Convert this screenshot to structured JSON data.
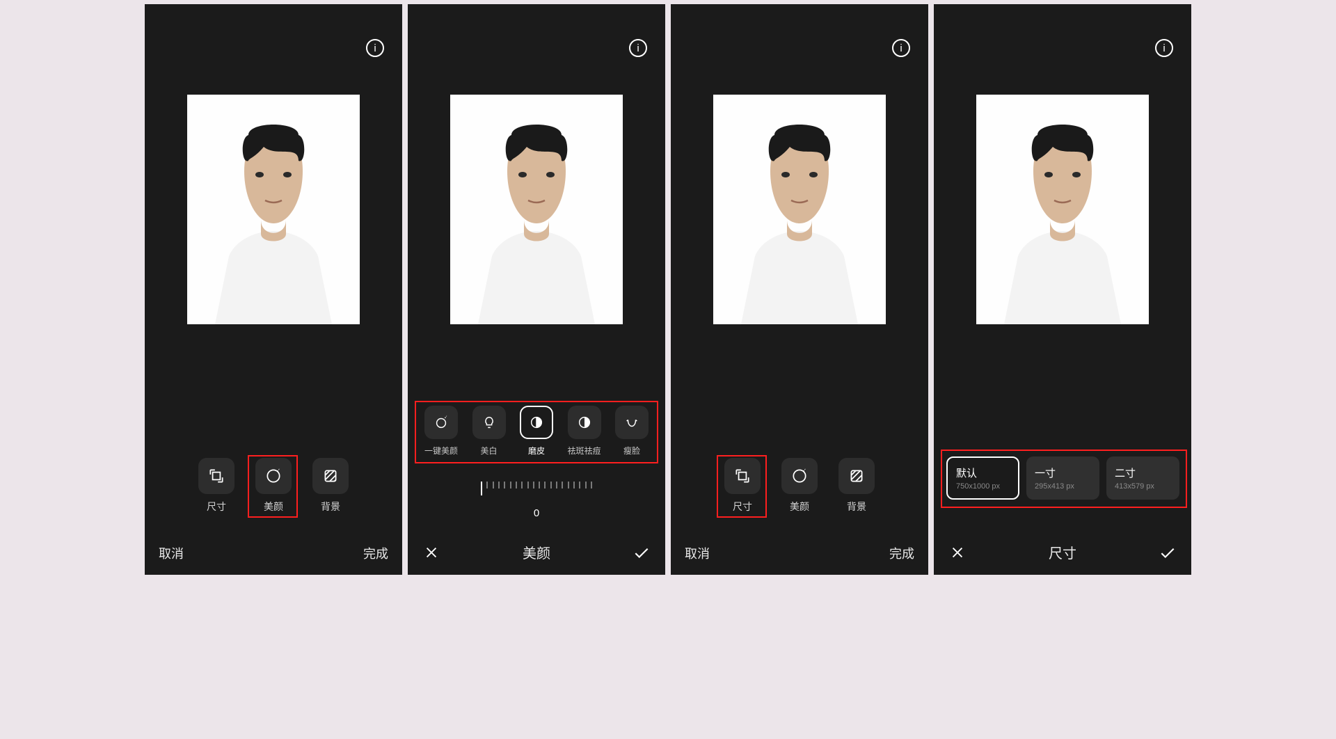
{
  "common": {
    "cancel": "取消",
    "done": "完成",
    "info_icon": "info-icon"
  },
  "tools": {
    "size": "尺寸",
    "beauty": "美颜",
    "background": "背景"
  },
  "panel2": {
    "title": "美颜",
    "slider_value": "0",
    "options": [
      {
        "label": "一键美颜",
        "icon": "sparkle-face"
      },
      {
        "label": "美白",
        "icon": "bulb"
      },
      {
        "label": "磨皮",
        "icon": "half-circle",
        "selected": true
      },
      {
        "label": "祛斑祛痘",
        "icon": "contrast"
      },
      {
        "label": "瘦脸",
        "icon": "face-outline"
      }
    ]
  },
  "panel4": {
    "title": "尺寸",
    "options": [
      {
        "name": "默认",
        "dim": "750x1000 px",
        "selected": true
      },
      {
        "name": "一寸",
        "dim": "295x413 px"
      },
      {
        "name": "二寸",
        "dim": "413x579 px"
      }
    ]
  }
}
